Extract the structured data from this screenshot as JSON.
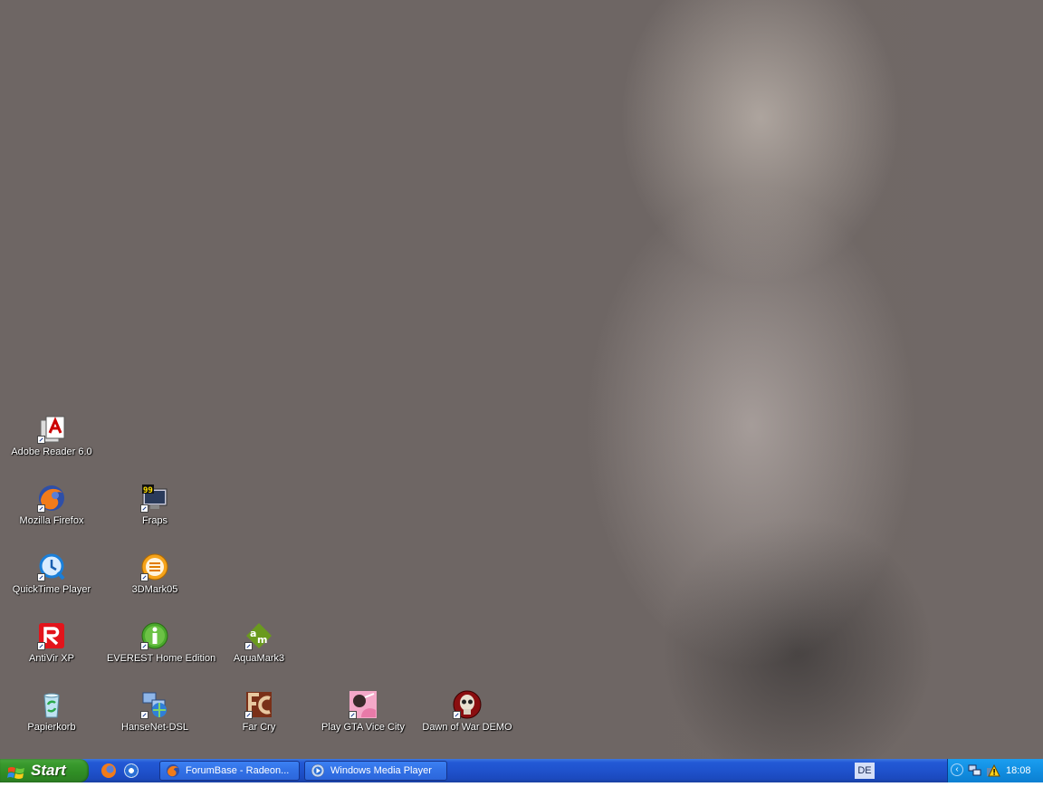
{
  "desktop": {
    "icons": [
      {
        "label": "Adobe Reader 6.0",
        "icon": "adobe-reader-icon"
      },
      {
        "label": "Mozilla Firefox",
        "icon": "firefox-icon"
      },
      {
        "label": "Fraps",
        "icon": "fraps-icon"
      },
      {
        "label": "QuickTime Player",
        "icon": "quicktime-icon"
      },
      {
        "label": "3DMark05",
        "icon": "3dmark-icon"
      },
      {
        "label": "AntiVir XP",
        "icon": "antivir-icon"
      },
      {
        "label": "EVEREST Home Edition",
        "icon": "everest-icon"
      },
      {
        "label": "AquaMark3",
        "icon": "aquamark-icon"
      },
      {
        "label": "Papierkorb",
        "icon": "recycle-bin-icon"
      },
      {
        "label": "HanseNet-DSL",
        "icon": "network-connection-icon"
      },
      {
        "label": "Far Cry",
        "icon": "far-cry-icon"
      },
      {
        "label": "Play GTA Vice City",
        "icon": "gta-vice-city-icon"
      },
      {
        "label": "Dawn of War DEMO",
        "icon": "dawn-of-war-icon"
      }
    ]
  },
  "taskbar": {
    "start_label": "Start",
    "quick_launch": [
      "firefox-icon",
      "media-player-icon"
    ],
    "tasks": [
      {
        "label": "ForumBase - Radeon...",
        "icon": "firefox-icon"
      },
      {
        "label": "Windows Media Player",
        "icon": "media-player-icon"
      }
    ],
    "language": "DE",
    "clock": "18:08"
  },
  "colors": {
    "wallpaper": "#6e6664",
    "taskbar": "#2359d6",
    "start_button": "#3a9a2e",
    "tray": "#1290e3"
  }
}
